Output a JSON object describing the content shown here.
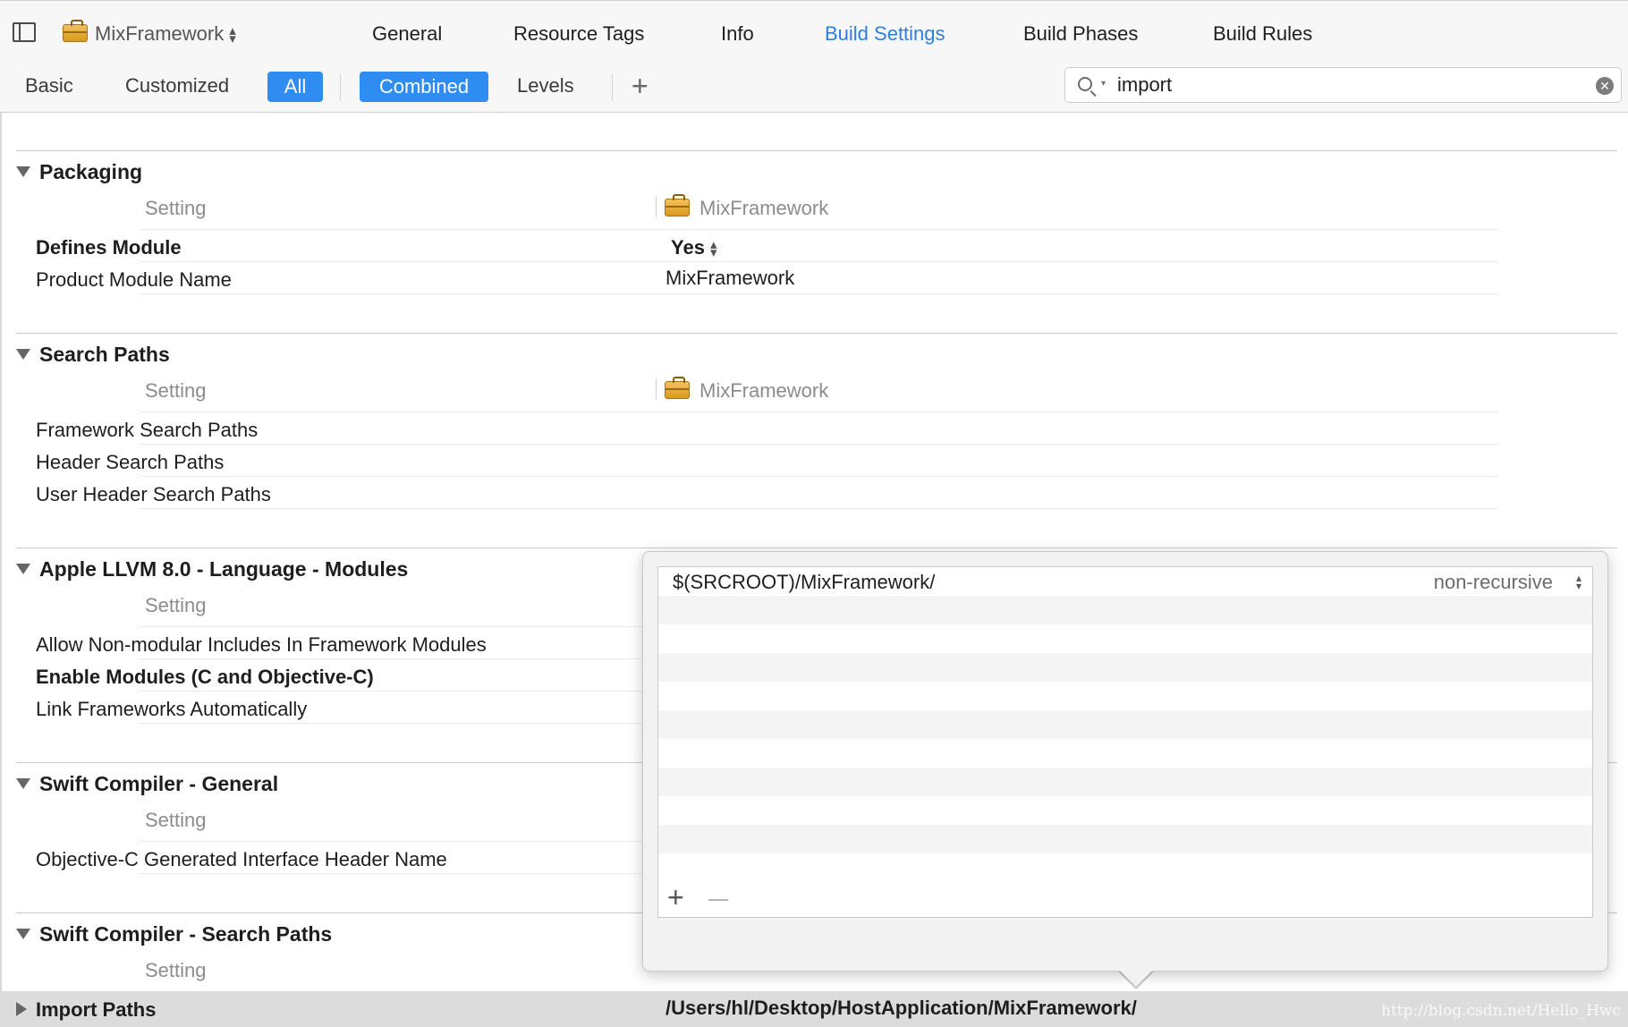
{
  "header": {
    "target_name": "MixFramework",
    "tabs": [
      {
        "label": "General",
        "active": false
      },
      {
        "label": "Resource Tags",
        "active": false
      },
      {
        "label": "Info",
        "active": false
      },
      {
        "label": "Build Settings",
        "active": true
      },
      {
        "label": "Build Phases",
        "active": false
      },
      {
        "label": "Build Rules",
        "active": false
      }
    ]
  },
  "filter": {
    "basic": "Basic",
    "customized": "Customized",
    "all": "All",
    "combined": "Combined",
    "levels": "Levels",
    "add_symbol": "+",
    "search_value": "import"
  },
  "sections": {
    "packaging": {
      "title": "Packaging",
      "setting_header": "Setting",
      "target_header": "MixFramework",
      "rows": [
        {
          "label": "Defines Module",
          "value": "Yes",
          "bold": true
        },
        {
          "label": "Product Module Name",
          "value": "MixFramework",
          "bold": false
        }
      ]
    },
    "search_paths": {
      "title": "Search Paths",
      "setting_header": "Setting",
      "target_header": "MixFramework",
      "rows": [
        {
          "label": "Framework Search Paths"
        },
        {
          "label": "Header Search Paths"
        },
        {
          "label": "User Header Search Paths"
        }
      ]
    },
    "llvm_modules": {
      "title": "Apple LLVM 8.0 - Language - Modules",
      "setting_header": "Setting",
      "rows": [
        {
          "label": "Allow Non-modular Includes In Framework Modules",
          "bold": false
        },
        {
          "label": "Enable Modules (C and Objective-C)",
          "bold": true
        },
        {
          "label": "Link Frameworks Automatically",
          "bold": false
        }
      ]
    },
    "swift_general": {
      "title": "Swift Compiler - General",
      "setting_header": "Setting",
      "rows": [
        {
          "label": "Objective-C Generated Interface Header Name"
        }
      ]
    },
    "swift_search_paths": {
      "title": "Swift Compiler - Search Paths",
      "setting_header": "Setting",
      "rows": [
        {
          "label": "Import Paths",
          "value": "/Users/hl/Desktop/HostApplication/MixFramework/",
          "bold": true,
          "selected": true
        }
      ]
    }
  },
  "popover": {
    "paths": [
      {
        "path": "$(SRCROOT)/MixFramework/",
        "mode": "non-recursive"
      }
    ],
    "add_symbol": "+",
    "empty_row_count": 11
  },
  "watermark": "http://blog.csdn.net/Hello_Hwc",
  "colors": {
    "accent": "#2f8cf0",
    "active_tab": "#2d7fdc",
    "selected_row": "#dcdcdc",
    "header_gray": "#8c8c8c"
  },
  "icons": [
    "sidebar-toggle-icon",
    "briefcase-icon",
    "search-icon",
    "clear-icon",
    "disclosure-triangle-icon",
    "stepper-icon"
  ]
}
